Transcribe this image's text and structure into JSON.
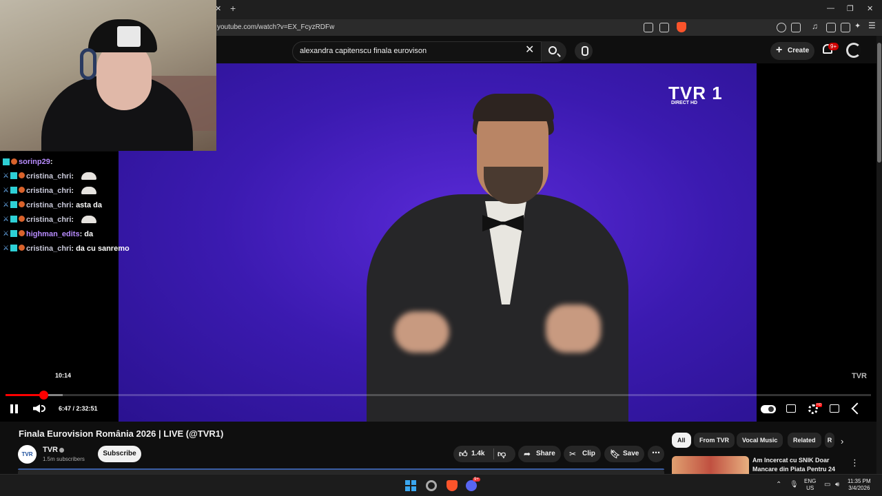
{
  "browser": {
    "url": "youtube.com/watch?v=EX_FcyzRDFw",
    "brave_badge": "1"
  },
  "header": {
    "search_query": "alexandra capitenscu finala eurovison",
    "create_label": "Create",
    "notif_count": "9+"
  },
  "video": {
    "channel_logo": "TVR 1",
    "channel_logo_sub": "DIRECT      HD",
    "watermark": "TVR",
    "hover_time": "10:14",
    "current_time": "6:47",
    "duration": "2:32:51",
    "timecode": "6:47 / 2:32:51",
    "progress_fraction": 0.044,
    "buffered_fraction": 0.066
  },
  "chat": [
    {
      "user": "sorinp29",
      "msg": "",
      "emote": false,
      "purple": true
    },
    {
      "user": "cristina_chri",
      "msg": "",
      "emote": true,
      "purple": false
    },
    {
      "user": "cristina_chri",
      "msg": "",
      "emote": true,
      "purple": false
    },
    {
      "user": "cristina_chri",
      "msg": "asta da",
      "emote": false,
      "purple": false
    },
    {
      "user": "cristina_chri",
      "msg": "",
      "emote": true,
      "purple": false
    },
    {
      "user": "highman_edits",
      "msg": "da",
      "emote": false,
      "purple": true
    },
    {
      "user": "cristina_chri",
      "msg": "da cu sanremo",
      "emote": false,
      "purple": false
    }
  ],
  "info": {
    "title": "Finala Eurovision România 2026 | LIVE (@TVR1)",
    "channel": "TVR",
    "avatar_text": "TVR",
    "subscribers": "1.5m subscribers",
    "subscribe_label": "Subscribe",
    "likes": "1.4k",
    "share_label": "Share",
    "clip_label": "Clip",
    "save_label": "Save"
  },
  "chips": [
    "All",
    "From TVR",
    "Vocal Music",
    "Related",
    "R"
  ],
  "recommendation": {
    "title": "Am Incercat cu SNIK Doar Mancare din Piata Pentru 24 ..."
  },
  "taskbar": {
    "lang_line1": "ENG",
    "lang_line2": "US",
    "time": "11:35 PM",
    "date": "3/4/2026",
    "discord_badge": "9+"
  },
  "colors": {
    "accent": "#ff0000",
    "video_bg": "#3b1ab0",
    "page_bg": "#0f0f0f"
  }
}
